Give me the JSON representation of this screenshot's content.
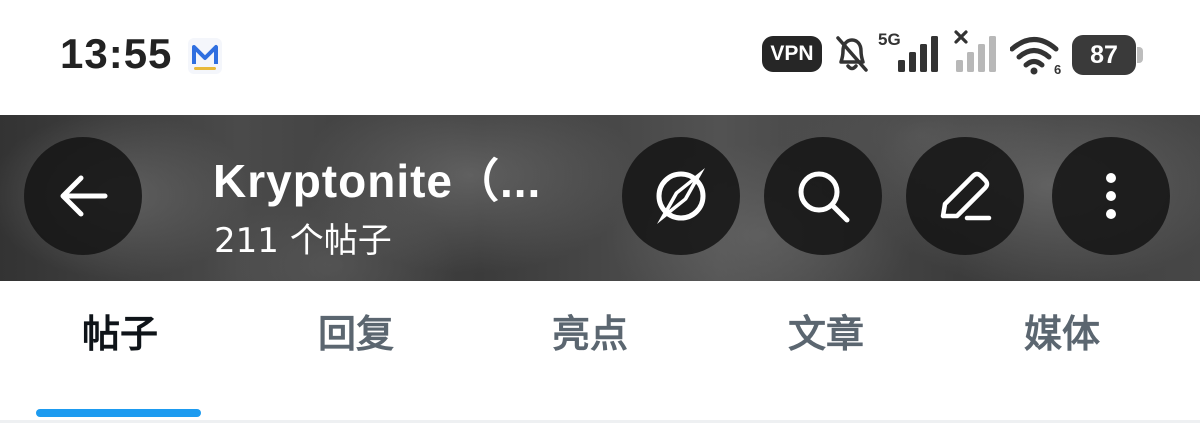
{
  "status_bar": {
    "time": "13:55",
    "vpn_label": "VPN",
    "network_label": "5G",
    "battery_level": "87"
  },
  "header": {
    "profile_name": "Kryptonite（...",
    "post_count": "211 个帖子"
  },
  "tabs": [
    {
      "label": "帖子",
      "active": true
    },
    {
      "label": "回复",
      "active": false
    },
    {
      "label": "亮点",
      "active": false
    },
    {
      "label": "文章",
      "active": false
    },
    {
      "label": "媒体",
      "active": false
    }
  ],
  "colors": {
    "accent": "#1d9bf0",
    "active_tab_text": "#0f1419",
    "inactive_tab_text": "#5b6670"
  }
}
